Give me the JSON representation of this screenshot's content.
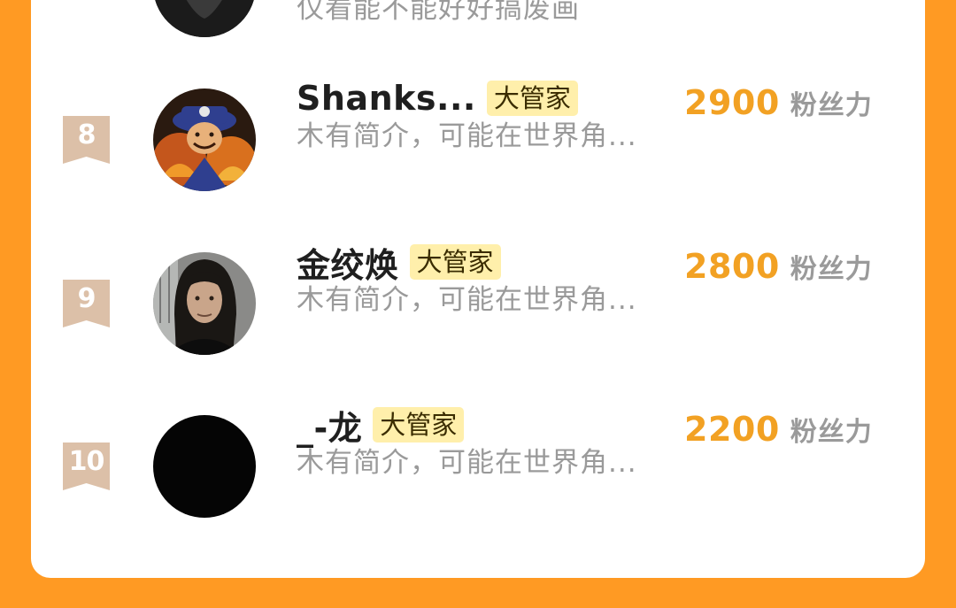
{
  "partial_row": {
    "intro": "仅看能不能好好搞废画"
  },
  "rows": [
    {
      "rank": "8",
      "name": "Shanks...",
      "tag": "大管家",
      "intro": "木有简介，可能在世界角...",
      "score": "2900",
      "unit": "粉丝力"
    },
    {
      "rank": "9",
      "name": "金绞焕",
      "tag": "大管家",
      "intro": "木有简介，可能在世界角...",
      "score": "2800",
      "unit": "粉丝力"
    },
    {
      "rank": "10",
      "name": "_-龙",
      "tag": "大管家",
      "intro": "木有简介，可能在世界角...",
      "score": "2200",
      "unit": "粉丝力"
    }
  ],
  "colors": {
    "background": "#ff9a23",
    "card": "#ffffff",
    "score": "#f2a123",
    "tag_bg": "#ffefab",
    "rank_badge": "#dcc0a8"
  }
}
